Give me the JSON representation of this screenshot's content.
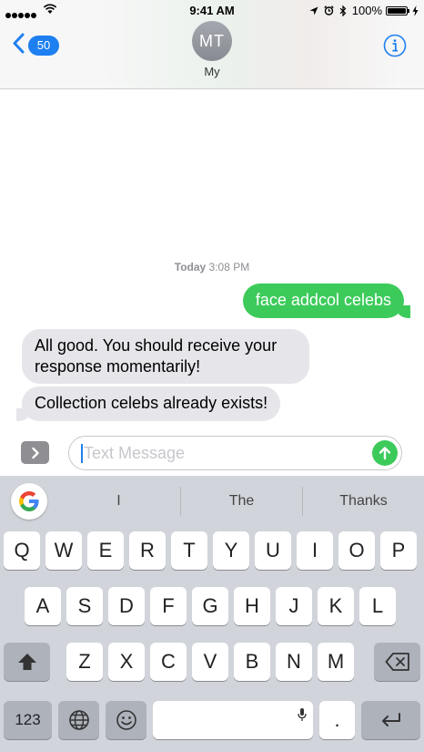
{
  "status_bar": {
    "time": "9:41 AM",
    "battery_text": "100%"
  },
  "nav": {
    "back_badge": "50",
    "avatar_initials": "MT",
    "contact_name": "My"
  },
  "conversation": {
    "timestamp_day": "Today",
    "timestamp_time": "3:08 PM",
    "messages": [
      {
        "direction": "outgoing",
        "text": "face addcol celebs"
      },
      {
        "direction": "incoming",
        "text": "All good. You should receive your response momentarily!"
      },
      {
        "direction": "incoming",
        "text": "Collection celebs already exists!"
      }
    ]
  },
  "input": {
    "placeholder": "Text Message"
  },
  "keyboard": {
    "google_letter": "G",
    "suggestions": [
      "I",
      "The",
      "Thanks"
    ],
    "row1": [
      "Q",
      "W",
      "E",
      "R",
      "T",
      "Y",
      "U",
      "I",
      "O",
      "P"
    ],
    "row2": [
      "A",
      "S",
      "D",
      "F",
      "G",
      "H",
      "J",
      "K",
      "L"
    ],
    "row3": [
      "Z",
      "X",
      "C",
      "V",
      "B",
      "N",
      "M"
    ],
    "numbers_key": "123",
    "period_key": "."
  },
  "colors": {
    "accent_blue": "#1e7ff0",
    "outgoing_bubble": "#3ccb5a",
    "incoming_bubble": "#e5e5ea"
  },
  "icons": {
    "back": "chevron-left-icon",
    "info": "info-icon",
    "apps": "chevron-right-icon",
    "send": "arrow-up-icon",
    "shift": "shift-icon",
    "delete": "backspace-icon",
    "globe": "globe-icon",
    "emoji": "emoji-icon",
    "mic": "microphone-icon",
    "return": "return-icon"
  }
}
